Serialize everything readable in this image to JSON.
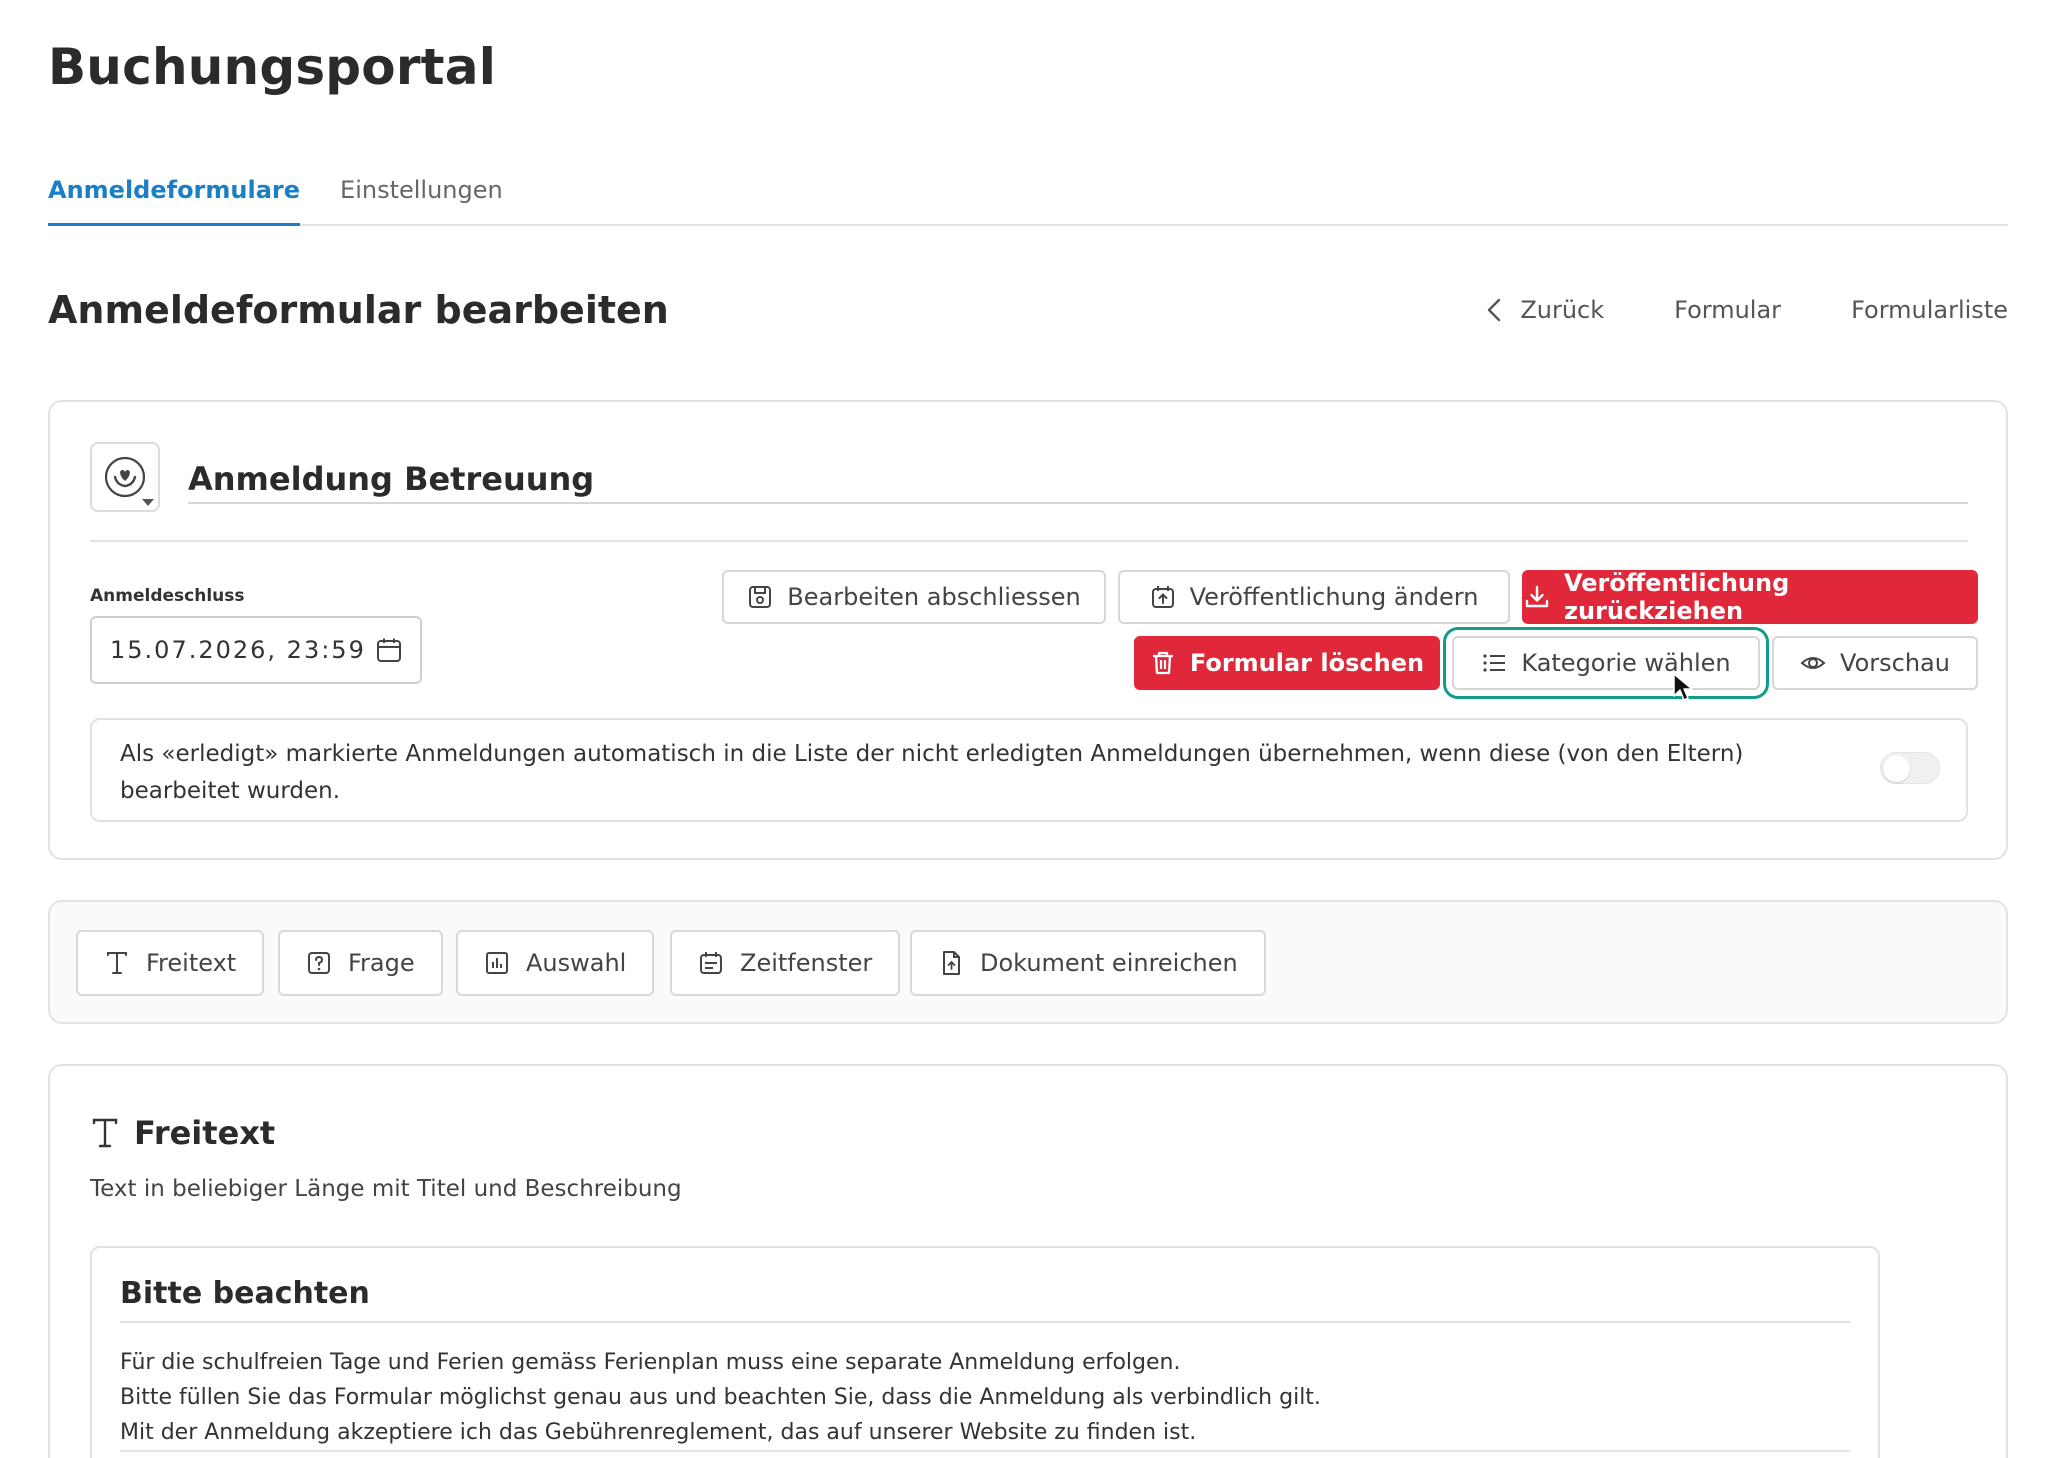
{
  "app": {
    "title": "Buchungsportal"
  },
  "tabs": [
    {
      "label": "Anmeldeformulare",
      "active": true
    },
    {
      "label": "Einstellungen",
      "active": false
    }
  ],
  "page": {
    "title": "Anmeldeformular bearbeiten",
    "nav": {
      "back_label": "Zurück",
      "form_label": "Formular",
      "list_label": "Formularliste"
    }
  },
  "form": {
    "title_value": "Anmeldung Betreuung",
    "icon": "care-hands-icon",
    "deadline": {
      "label": "Anmeldeschluss",
      "value": "15.07.2026, 23:59"
    },
    "actions": {
      "finish_edit": "Bearbeiten abschliessen",
      "change_publish": "Veröffentlichung ändern",
      "withdraw_publish": "Veröffentlichung zurückziehen",
      "delete_form": "Formular löschen",
      "choose_category": "Kategorie wählen",
      "preview": "Vorschau"
    },
    "toggle": {
      "text": "Als «erledigt» markierte Anmeldungen automatisch in die Liste der nicht erledigten Anmeldungen übernehmen, wenn diese (von den Eltern) bearbeitet wurden.",
      "enabled": false
    }
  },
  "toolbar": {
    "items": [
      {
        "label": "Freitext",
        "icon": "text-icon"
      },
      {
        "label": "Frage",
        "icon": "question-icon"
      },
      {
        "label": "Auswahl",
        "icon": "chart-icon"
      },
      {
        "label": "Zeitfenster",
        "icon": "calendar-icon"
      },
      {
        "label": "Dokument einreichen",
        "icon": "document-icon"
      }
    ]
  },
  "block": {
    "type_label": "Freitext",
    "description": "Text in beliebiger Länge mit Titel und Beschreibung",
    "notice_title": "Bitte beachten",
    "notice_lines": [
      "Für die schulfreien Tage und Ferien gemäss Ferienplan muss eine separate Anmeldung erfolgen.",
      "Bitte füllen Sie das Formular möglichst genau aus und beachten Sie, dass die Anmeldung als verbindlich gilt.",
      "Mit der Anmeldung akzeptiere ich das Gebührenreglement, das auf unserer Website zu finden ist."
    ]
  },
  "colors": {
    "accent": "#1a7fc4",
    "danger": "#e0283a",
    "highlight": "#129c8c"
  }
}
